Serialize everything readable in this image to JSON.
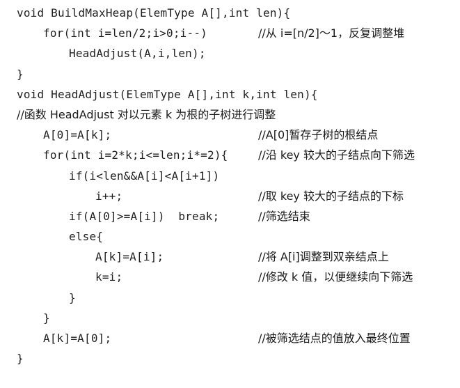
{
  "lines": [
    {
      "code": "void BuildMaxHeap(ElemType A[],int len){",
      "comment": ""
    },
    {
      "code": "for(int i=len/2;i>0;i--)",
      "comment": "//从 i=[n/2]～1，反复调整堆"
    },
    {
      "code": "HeadAdjust(A,i,len);",
      "comment": ""
    },
    {
      "code": "}",
      "comment": ""
    },
    {
      "code": "void HeadAdjust(ElemType A[],int k,int len){",
      "comment": ""
    },
    {
      "code": "//函数 HeadAdjust 对以元素 k 为根的子树进行调整",
      "comment": ""
    },
    {
      "code": "A[0]=A[k];",
      "comment": "//A[0]暂存子树的根结点"
    },
    {
      "code": "for(int i=2*k;i<=len;i*=2){",
      "comment": "//沿 key 较大的子结点向下筛选"
    },
    {
      "code": "if(i<len&&A[i]<A[i+1])",
      "comment": ""
    },
    {
      "code": "i++;",
      "comment": "//取 key 较大的子结点的下标"
    },
    {
      "code": "if(A[0]>=A[i])  break;",
      "comment": "//筛选结束"
    },
    {
      "code": "else{",
      "comment": ""
    },
    {
      "code": "A[k]=A[i];",
      "comment": "//将 A[i]调整到双亲结点上"
    },
    {
      "code": "k=i;",
      "comment": "//修改 k 值，以便继续向下筛选"
    },
    {
      "code": "}",
      "comment": ""
    },
    {
      "code": "}",
      "comment": ""
    },
    {
      "code": "A[k]=A[0];",
      "comment": "//被筛选结点的值放入最终位置"
    },
    {
      "code": "}",
      "comment": ""
    }
  ]
}
